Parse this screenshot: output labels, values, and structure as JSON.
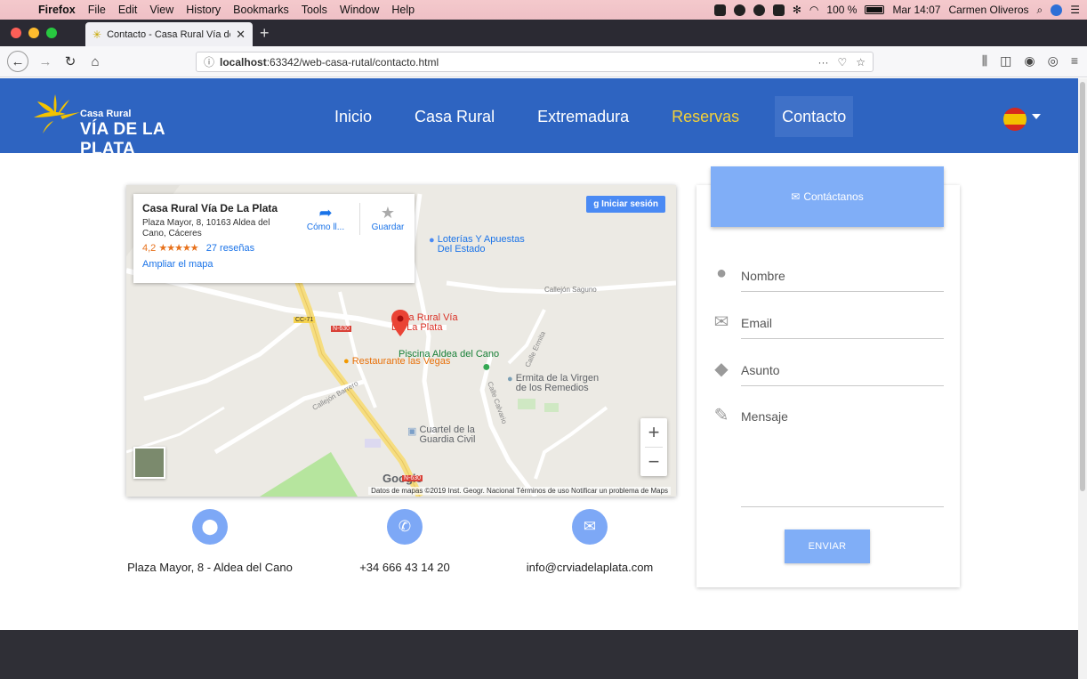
{
  "os_menubar": {
    "app": "Firefox",
    "items": [
      "File",
      "Edit",
      "View",
      "History",
      "Bookmarks",
      "Tools",
      "Window",
      "Help"
    ],
    "battery": "100 %",
    "clock": "Mar 14:07",
    "user": "Carmen Oliveros"
  },
  "browser": {
    "tab_title": "Contacto - Casa Rural Vía de la",
    "url_prefix": "localhost",
    "url_rest": ":63342/web-casa-rutal/contacto.html",
    "url_actions": "···"
  },
  "site": {
    "logo_small": "Casa Rural",
    "logo_big": "VÍA DE LA PLATA",
    "nav": [
      "Inicio",
      "Casa Rural",
      "Extremadura",
      "Reservas",
      "Contacto"
    ],
    "flag": "ES"
  },
  "map": {
    "place_name": "Casa Rural Vía De La Plata",
    "address": "Plaza Mayor, 8, 10163 Aldea del Cano, Cáceres",
    "rating": "4,2",
    "stars": "★★★★★",
    "reviews": "27 reseñas",
    "enlarge": "Ampliar el mapa",
    "directions": "Cómo ll...",
    "save": "Guardar",
    "signin": "Iniciar sesión",
    "zoom_in": "+",
    "zoom_out": "−",
    "google": "Google",
    "footer": "Datos de mapas ©2019 Inst. Geogr. Nacional   Términos de uso   Notificar un problema de Maps",
    "labels": {
      "loterias": "Loterías Y Apuestas\nDel Estado",
      "casa": "Casa Rural Vía\nDe La Plata",
      "piscina": "Piscina Aldea del Cano",
      "restaurante": "Restaurante las Vegas",
      "ermita": "Ermita de la Virgen\nde los Remedios",
      "cuartel": "Cuartel de la\nGuardia Civil",
      "callejon_saguno": "Callejón Saguno",
      "callejon_barrero": "Callejón Barrero",
      "calle_ermita": "Calle Ermita",
      "calle_calvario": "Calle Calvario",
      "road_cc71": "CC-71",
      "road_n630": "N-630",
      "road_n630b": "N-630"
    }
  },
  "contact": {
    "address": "Plaza Mayor, 8 - Aldea del Cano",
    "phone": "+34 666 43 14 20",
    "email": "info@crviadelaplata.com"
  },
  "form": {
    "title": "Contáctanos",
    "name": "Nombre",
    "email": "Email",
    "subject": "Asunto",
    "message": "Mensaje",
    "submit": "ENVIAR"
  },
  "colors": {
    "nav_bg": "#2e64c1",
    "accent": "#80aef7",
    "reservas": "#f3d037",
    "footer": "#2f2f36"
  }
}
